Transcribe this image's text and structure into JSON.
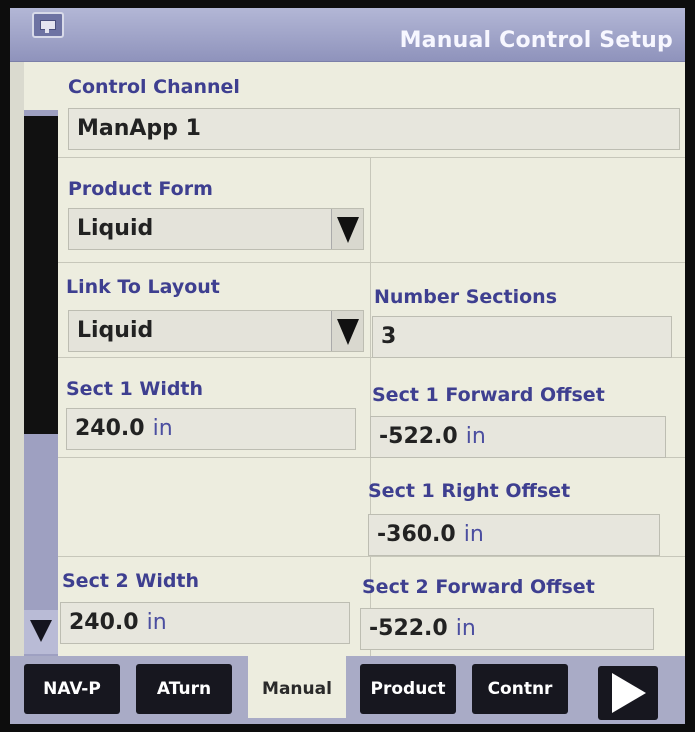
{
  "header": {
    "title": "Manual Control Setup",
    "icon": "settings-screen-icon"
  },
  "control_channel": {
    "label": "Control Channel",
    "value": "ManApp 1"
  },
  "product_form": {
    "label": "Product Form",
    "value": "Liquid"
  },
  "link_to_layout": {
    "label": "Link To Layout",
    "value": "Liquid"
  },
  "number_sections": {
    "label": "Number Sections",
    "value": "3"
  },
  "sect1_width": {
    "label": "Sect 1 Width",
    "value": "240.0",
    "unit": "in"
  },
  "sect1_forward_offset": {
    "label": "Sect 1 Forward Offset",
    "value": "-522.0",
    "unit": "in"
  },
  "sect1_right_offset": {
    "label": "Sect 1 Right Offset",
    "value": "-360.0",
    "unit": "in"
  },
  "sect2_width": {
    "label": "Sect 2 Width",
    "value": "240.0",
    "unit": "in"
  },
  "sect2_forward_offset": {
    "label": "Sect 2 Forward Offset",
    "value": "-522.0",
    "unit": "in"
  },
  "tabs": [
    {
      "label": "NAV-P",
      "active": false
    },
    {
      "label": "ATurn",
      "active": false
    },
    {
      "label": "Manual",
      "active": true
    },
    {
      "label": "Product",
      "active": false
    },
    {
      "label": "Contnr",
      "active": false
    }
  ],
  "colors": {
    "title_bar": "#9a9ec6",
    "label_text": "#3e3f90",
    "panel": "#ededdf",
    "tab_dark": "#17171f"
  }
}
